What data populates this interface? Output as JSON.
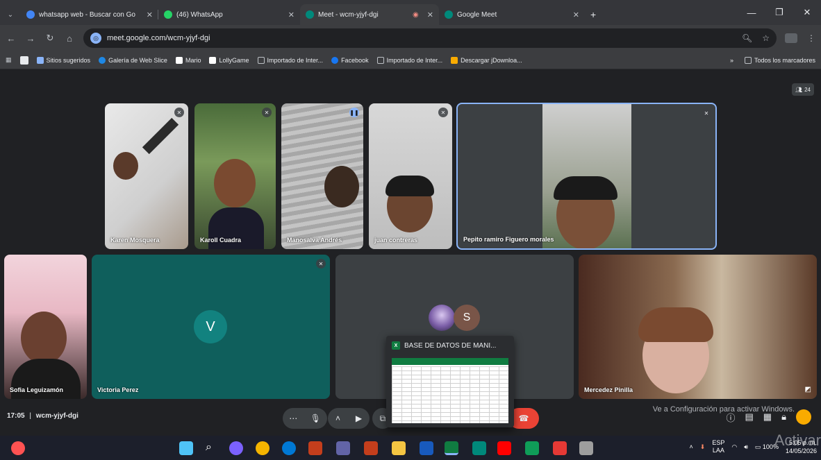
{
  "browser": {
    "tabs": [
      {
        "title": "whatsapp web - Buscar con Go",
        "color": "#4285f4",
        "close": "✕"
      },
      {
        "title": "(46) WhatsApp",
        "color": "#25d366",
        "close": "✕"
      },
      {
        "title": "Meet - wcm-yjyf-dgi",
        "color": "#00897b",
        "close": "✕"
      },
      {
        "title": "Google Meet",
        "color": "#00897b",
        "close": "✕"
      }
    ],
    "new_tab": "+",
    "url": "meet.google.com/wcm-yjyf-dgi",
    "bookmarks": [
      {
        "label": "Sitios sugeridos",
        "color": "#8ab4f8"
      },
      {
        "label": "Galería de Web Slice",
        "color": "#1e88e5"
      },
      {
        "label": "Mario",
        "color": "#ffffff"
      },
      {
        "label": "LollyGame",
        "color": "#ffffff"
      },
      {
        "label": "Importado de Inter...",
        "color": "#bdc1c6"
      },
      {
        "label": "Facebook",
        "color": "#1877f2"
      },
      {
        "label": "Importado de Inter...",
        "color": "#bdc1c6"
      },
      {
        "label": "Descargar jDownloa...",
        "color": "#f9ab00"
      }
    ],
    "bookmarks_more": "»",
    "all_bookmarks": "Todos los marcadores"
  },
  "meet": {
    "participant_count": "24",
    "participants": [
      {
        "name": "Karen Mosquera"
      },
      {
        "name": "Karoll Cuadra"
      },
      {
        "name": "Manosalva Andrés"
      },
      {
        "name": "juan contreras"
      },
      {
        "name": "Pepito ramiro Figuero morales"
      },
      {
        "name": "Sofia Leguizamón"
      },
      {
        "name": "Victoria Perez",
        "initial": "V"
      },
      {
        "name": "",
        "initial": "S"
      },
      {
        "name": "Mercedez Pinilla"
      }
    ],
    "time": "17:05",
    "separator": "|",
    "meeting_code": "wcm-yjyf-dgi",
    "windows_activation": "Ve a Configuración para activar Windows."
  },
  "preview": {
    "title": "BASE DE DATOS DE MANI..."
  },
  "taskbar": {
    "lang": "ESP",
    "lang2": "LAA",
    "battery": "100%",
    "clock_time": "5:05 p. m.",
    "clock_date": "14/05/2026",
    "activar": "Activar"
  },
  "colors": {
    "meet_bg": "#202124",
    "accent_blue": "#8ab4f8",
    "end_call": "#ea4335",
    "teal_tile": "#0f5f5c"
  }
}
